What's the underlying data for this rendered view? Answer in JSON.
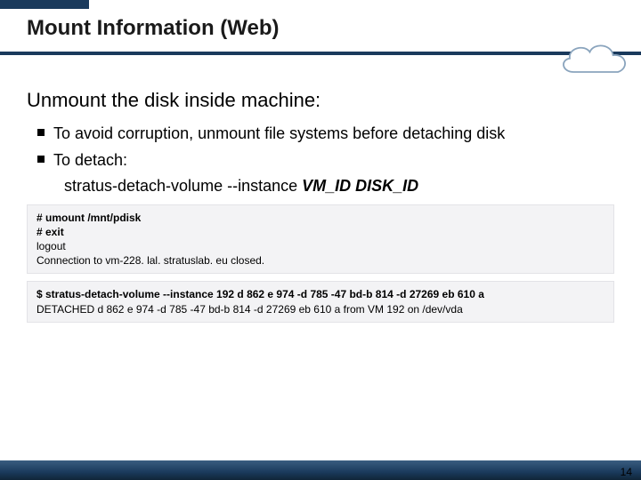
{
  "title": "Mount Information (Web)",
  "subhead": "Unmount the disk inside machine:",
  "bullets": [
    {
      "text": "To avoid corruption, unmount file systems before detaching disk"
    },
    {
      "text": "To detach:"
    }
  ],
  "detach_cmd": {
    "cmd": "stratus-detach-volume --instance ",
    "args": "VM_ID DISK_ID"
  },
  "code1": {
    "l1": "# umount /mnt/pdisk",
    "l2": "# exit",
    "l3": "logout",
    "l4": "Connection to vm-228. lal. stratuslab. eu closed."
  },
  "code2": {
    "l1": "$ stratus-detach-volume --instance 192 d 862 e 974 -d 785 -47 bd-b 814 -d 27269 eb 610 a",
    "l2": "DETACHED d 862 e 974 -d 785 -47 bd-b 814 -d 27269 eb 610 a from VM 192 on /dev/vda"
  },
  "page_number": "14",
  "colors": {
    "accent": "#1a3a5c"
  }
}
